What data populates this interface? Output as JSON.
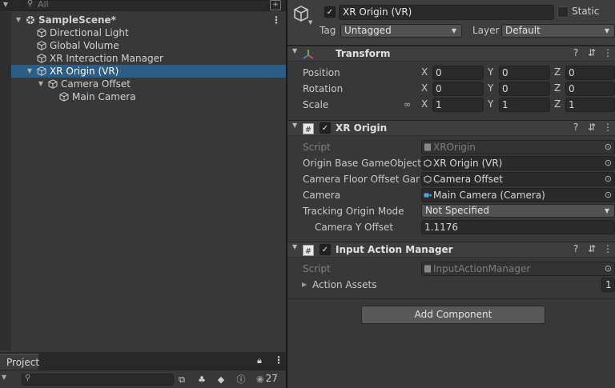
{
  "hierarchy": {
    "search_placeholder": "All",
    "items": [
      {
        "label": "SampleScene*",
        "indent": 0,
        "fold": "▼",
        "scene": true
      },
      {
        "label": "Directional Light",
        "indent": 1
      },
      {
        "label": "Global Volume",
        "indent": 1
      },
      {
        "label": "XR Interaction Manager",
        "indent": 1
      },
      {
        "label": "XR Origin (VR)",
        "indent": 1,
        "fold": "▼",
        "selected": true
      },
      {
        "label": "Camera Offset",
        "indent": 2,
        "fold": "▼"
      },
      {
        "label": "Main Camera",
        "indent": 3
      }
    ]
  },
  "project": {
    "tab_label": "Project",
    "hidden_count": "27"
  },
  "inspector": {
    "object_name": "XR Origin (VR)",
    "object_active": true,
    "static_label": "Static",
    "static_checked": false,
    "tag_label": "Tag",
    "tag_value": "Untagged",
    "layer_label": "Layer",
    "layer_value": "Default",
    "transform": {
      "title": "Transform",
      "position_label": "Position",
      "rotation_label": "Rotation",
      "scale_label": "Scale",
      "axis_x": "X",
      "axis_y": "Y",
      "axis_z": "Z",
      "position": [
        "0",
        "0",
        "0"
      ],
      "rotation": [
        "0",
        "0",
        "0"
      ],
      "scale": [
        "1",
        "1",
        "1"
      ]
    },
    "xr_origin": {
      "title": "XR Origin",
      "script_label": "Script",
      "script_value": "XROrigin",
      "origin_base_label": "Origin Base GameObject",
      "origin_base_value": "XR Origin (VR)",
      "camera_floor_label": "Camera Floor Offset Game",
      "camera_floor_value": "Camera Offset",
      "camera_label": "Camera",
      "camera_value": "Main Camera (Camera)",
      "tracking_label": "Tracking Origin Mode",
      "tracking_value": "Not Specified",
      "camera_y_label": "Camera Y Offset",
      "camera_y_value": "1.1176"
    },
    "input_action_manager": {
      "title": "Input Action Manager",
      "script_label": "Script",
      "script_value": "InputActionManager",
      "action_assets_label": "Action Assets",
      "action_assets_count": "1"
    },
    "add_component_label": "Add Component"
  },
  "colors": {
    "panel_bg": "#383838",
    "header_bg": "#3e3e3e",
    "selection": "#2c5d87",
    "field_bg": "#2a2a2a",
    "button_bg": "#585858"
  }
}
